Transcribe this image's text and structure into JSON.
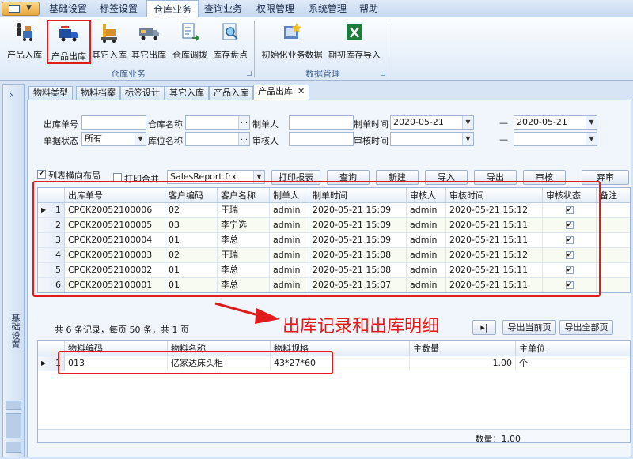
{
  "menu": {
    "items": [
      "基础设置",
      "标签设置",
      "仓库业务",
      "查询业务",
      "权限管理",
      "系统管理",
      "帮助"
    ],
    "active_index": 2
  },
  "ribbon": {
    "groups": [
      {
        "title": "仓库业务",
        "buttons": [
          {
            "label": "产品入库",
            "icon": "forklift-worker-icon"
          },
          {
            "label": "产品出库",
            "icon": "delivery-truck-icon",
            "highlighted": true
          },
          {
            "label": "其它入库",
            "icon": "pallet-truck-icon"
          },
          {
            "label": "其它出库",
            "icon": "van-icon"
          },
          {
            "label": "仓库调拨",
            "icon": "transfer-document-icon"
          },
          {
            "label": "库存盘点",
            "icon": "inventory-search-icon"
          }
        ]
      },
      {
        "title": "数据管理",
        "buttons": [
          {
            "label": "初始化业务数据",
            "icon": "init-data-icon"
          },
          {
            "label": "期初库存导入",
            "icon": "excel-import-icon"
          }
        ]
      }
    ]
  },
  "sidebar": {
    "title": "基础设置",
    "collapse_glyph": "›"
  },
  "tabs": [
    {
      "label": "物料类型"
    },
    {
      "label": "物料档案"
    },
    {
      "label": "标签设计"
    },
    {
      "label": "其它入库"
    },
    {
      "label": "产品入库"
    },
    {
      "label": "产品出库",
      "active": true,
      "close_glyph": "✕"
    }
  ],
  "filters": {
    "order_no": {
      "label": "出库单号",
      "value": ""
    },
    "warehouse": {
      "label": "仓库名称",
      "value": ""
    },
    "creator": {
      "label": "制单人",
      "value": ""
    },
    "create_time": {
      "label": "制单时间",
      "from": "2020-05-21",
      "dash": "—",
      "to": "2020-05-21"
    },
    "status": {
      "label": "单据状态",
      "value": "所有"
    },
    "location": {
      "label": "库位名称",
      "value": ""
    },
    "auditor": {
      "label": "审核人",
      "value": ""
    },
    "audit_time": {
      "label": "审核时间",
      "from": "",
      "dash": "—",
      "to": ""
    }
  },
  "toolbar": {
    "list_layout_label": "列表横向布局",
    "list_layout_checked": true,
    "print_merge_label": "打印合并",
    "print_merge_checked": false,
    "report_file": "SalesReport.frx",
    "print_report": "打印报表",
    "query": "查询",
    "new": "新建",
    "import": "导入",
    "export": "导出",
    "audit": "审核",
    "abandon": "弃审"
  },
  "main_grid": {
    "columns": [
      "出库单号",
      "客户编码",
      "客户名称",
      "制单人",
      "制单时间",
      "审核人",
      "审核时间",
      "审核状态",
      "备注"
    ],
    "rows": [
      {
        "no": "1",
        "order": "CPCK20052100006",
        "code": "02",
        "name": "王瑞",
        "creator": "admin",
        "ctime": "2020-05-21 15:09",
        "auditor": "admin",
        "atime": "2020-05-21 15:12",
        "audited": true,
        "note": ""
      },
      {
        "no": "2",
        "order": "CPCK20052100005",
        "code": "03",
        "name": "李宁选",
        "creator": "admin",
        "ctime": "2020-05-21 15:09",
        "auditor": "admin",
        "atime": "2020-05-21 15:11",
        "audited": true,
        "note": ""
      },
      {
        "no": "3",
        "order": "CPCK20052100004",
        "code": "01",
        "name": "李总",
        "creator": "admin",
        "ctime": "2020-05-21 15:09",
        "auditor": "admin",
        "atime": "2020-05-21 15:11",
        "audited": true,
        "note": ""
      },
      {
        "no": "4",
        "order": "CPCK20052100003",
        "code": "02",
        "name": "王瑞",
        "creator": "admin",
        "ctime": "2020-05-21 15:08",
        "auditor": "admin",
        "atime": "2020-05-21 15:12",
        "audited": true,
        "note": ""
      },
      {
        "no": "5",
        "order": "CPCK20052100002",
        "code": "01",
        "name": "李总",
        "creator": "admin",
        "ctime": "2020-05-21 15:08",
        "auditor": "admin",
        "atime": "2020-05-21 15:11",
        "audited": true,
        "note": ""
      },
      {
        "no": "6",
        "order": "CPCK20052100001",
        "code": "01",
        "name": "李总",
        "creator": "admin",
        "ctime": "2020-05-21 15:07",
        "auditor": "admin",
        "atime": "2020-05-21 15:11",
        "audited": true,
        "note": ""
      }
    ],
    "current_row": 0
  },
  "pager": {
    "summary": "共 6 条记录，每页 50 条，共 1 页",
    "last_page_glyph": "▸|",
    "export_current": "导出当前页",
    "export_all": "导出全部页"
  },
  "annotation": "出库记录和出库明细",
  "detail_grid": {
    "columns": [
      "物料编码",
      "物料名称",
      "物料规格",
      "主数量",
      "主单位"
    ],
    "rows": [
      {
        "no": "1",
        "code": "013",
        "name": "亿家达床头柜",
        "spec": "43*27*60",
        "qty": "1.00",
        "unit": "个"
      }
    ],
    "footer": "数量：1.00"
  },
  "colors": {
    "highlight_red": "#e21b1b",
    "ribbon_bg": "#dde9f7",
    "row_alt": "#f7fbf2"
  }
}
